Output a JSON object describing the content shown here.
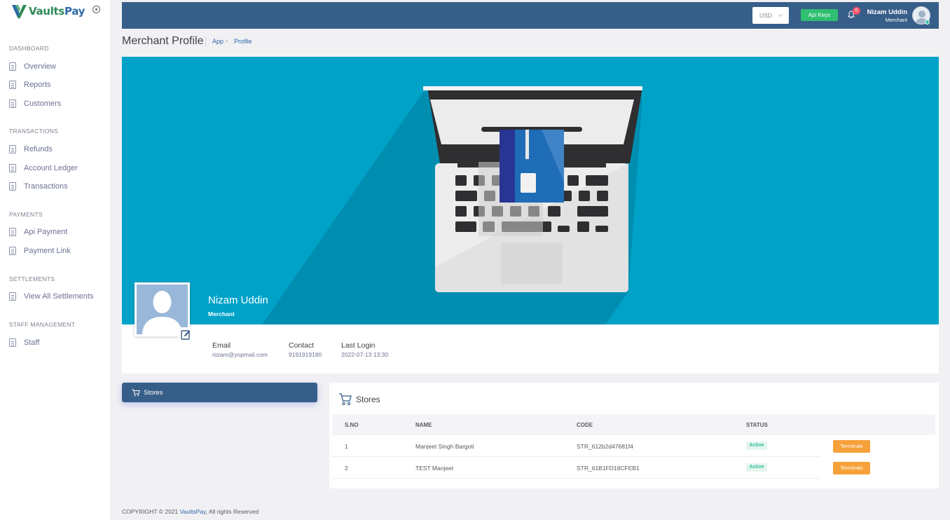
{
  "brand": {
    "name_part1": "Vaults",
    "name_part2": "Pay"
  },
  "sidebar": {
    "sections": [
      {
        "title": "Dashboard",
        "items": [
          {
            "label": "Overview"
          },
          {
            "label": "Reports"
          },
          {
            "label": "Customers"
          }
        ]
      },
      {
        "title": "Transactions",
        "items": [
          {
            "label": "Refunds"
          },
          {
            "label": "Account Ledger"
          },
          {
            "label": "Transactions"
          }
        ]
      },
      {
        "title": "Payments",
        "items": [
          {
            "label": "Api Payment"
          },
          {
            "label": "Payment Link"
          }
        ]
      },
      {
        "title": "Settlements",
        "items": [
          {
            "label": "View All Settlements"
          }
        ]
      },
      {
        "title": "Staff Management",
        "items": [
          {
            "label": "Staff"
          }
        ]
      }
    ]
  },
  "header": {
    "currency": "USD",
    "api_keys_label": "Api Keys",
    "notification_count": "0",
    "user_name": "Nizam Uddin",
    "user_role": "Merchant"
  },
  "subheader": {
    "title": "Merchant Profile",
    "breadcrumb": [
      "App",
      "Profile"
    ]
  },
  "profile": {
    "name": "Nizam Uddin",
    "role": "Merchant",
    "email_label": "Email",
    "email": "nizam@yopmail.com",
    "contact_label": "Contact",
    "contact": "9191919180",
    "last_login_label": "Last Login",
    "last_login": "2022-07-13 13:30"
  },
  "tabs": {
    "stores_label": "Stores"
  },
  "stores": {
    "title": "Stores",
    "columns": [
      "S.NO",
      "NAME",
      "CODE",
      "STATUS"
    ],
    "rows": [
      {
        "sno": "1",
        "name": "Manjeet Singh Bargoti",
        "code": "STR_612b2d47681f4",
        "status": "Active",
        "action": "Terminals"
      },
      {
        "sno": "2",
        "name": "TEST Manjeet",
        "code": "STR_61B1FD18CFEB1",
        "status": "Active",
        "action": "Terminals"
      }
    ]
  },
  "footer": {
    "prefix": "COPYRIGHT © 2021 ",
    "link": "VaultsPay",
    "suffix": ", All rights Reserved"
  },
  "colors": {
    "header": "#375e89",
    "banner": "#00a2c8",
    "accent_green": "#2fbf71",
    "terminals_orange": "#f7a13a"
  }
}
